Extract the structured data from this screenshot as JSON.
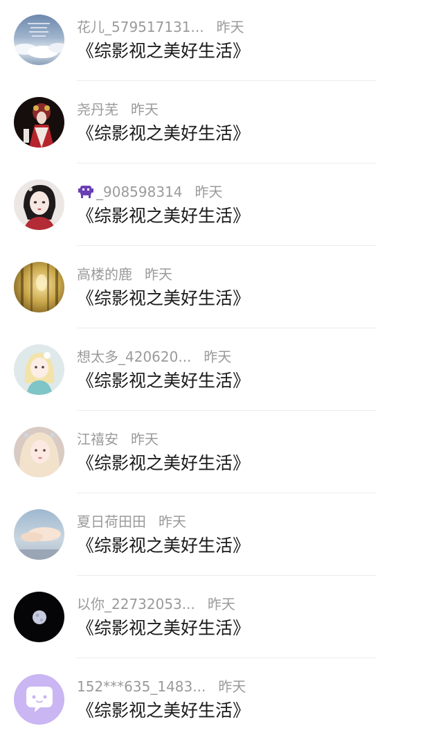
{
  "messages": [
    {
      "name": "花儿_579517131...",
      "time": "昨天",
      "text": "《综影视之美好生活》",
      "avatar_icon": "clouds-poem-avatar"
    },
    {
      "name": "尧丹芜",
      "time": "昨天",
      "text": "《综影视之美好生活》",
      "avatar_icon": "opera-figure-avatar"
    },
    {
      "name": "_908598314",
      "time": "昨天",
      "text": "《综影视之美好生活》",
      "avatar_icon": "anime-girl-avatar",
      "name_prefix_icon": "purple-alien-emoji-icon"
    },
    {
      "name": "高楼的鹿",
      "time": "昨天",
      "text": "《综影视之美好生活》",
      "avatar_icon": "golden-window-avatar"
    },
    {
      "name": "想太多_420620...",
      "time": "昨天",
      "text": "《综影视之美好生活》",
      "avatar_icon": "cartoon-doll-avatar"
    },
    {
      "name": "江禧安",
      "time": "昨天",
      "text": "《综影视之美好生活》",
      "avatar_icon": "blonde-girl-avatar"
    },
    {
      "name": "夏日荷田田",
      "time": "昨天",
      "text": "《综影视之美好生活》",
      "avatar_icon": "sky-clouds-avatar"
    },
    {
      "name": "以你_22732053...",
      "time": "昨天",
      "text": "《综影视之美好生活》",
      "avatar_icon": "moon-avatar"
    },
    {
      "name": "152***635_1483...",
      "time": "昨天",
      "text": "《综影视之美好生活》",
      "avatar_icon": "default-chat-avatar"
    }
  ],
  "colors": {
    "name_text": "#9a9a9a",
    "message_text": "#1a1a1a",
    "divider": "#ececec",
    "default_avatar_bg": "#c9b6f2"
  }
}
